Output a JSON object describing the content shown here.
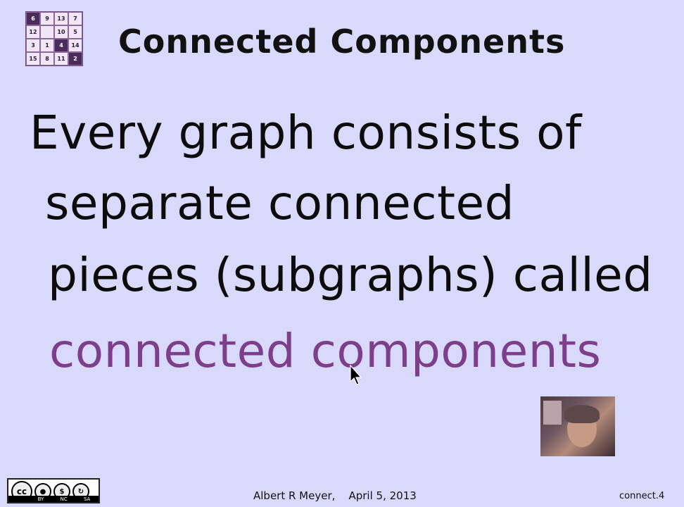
{
  "logo": {
    "cells": [
      {
        "label": "6",
        "style": "dark"
      },
      {
        "label": "9",
        "style": "light"
      },
      {
        "label": "13",
        "style": "light"
      },
      {
        "label": "7",
        "style": "light"
      },
      {
        "label": "12",
        "style": "light"
      },
      {
        "label": "",
        "style": "light"
      },
      {
        "label": "10",
        "style": "light"
      },
      {
        "label": "5",
        "style": "light"
      },
      {
        "label": "3",
        "style": "light"
      },
      {
        "label": "1",
        "style": "light"
      },
      {
        "label": "4",
        "style": "dark"
      },
      {
        "label": "14",
        "style": "light"
      },
      {
        "label": "15",
        "style": "light"
      },
      {
        "label": "8",
        "style": "light"
      },
      {
        "label": "11",
        "style": "light"
      },
      {
        "label": "2",
        "style": "dark"
      }
    ]
  },
  "slide": {
    "title": "Connected Components",
    "lines": [
      "Every graph consists of",
      "separate connected",
      "pieces (subgraphs) called",
      "connected components"
    ]
  },
  "colors": {
    "background": "#d9d9fb",
    "highlight": "#7d3f8a"
  },
  "license": {
    "cc": "cc",
    "labels": [
      "BY",
      "NC",
      "SA"
    ]
  },
  "footer": {
    "author_date": "Albert R Meyer,    April 5, 2013",
    "slide_id": "connect.4"
  }
}
